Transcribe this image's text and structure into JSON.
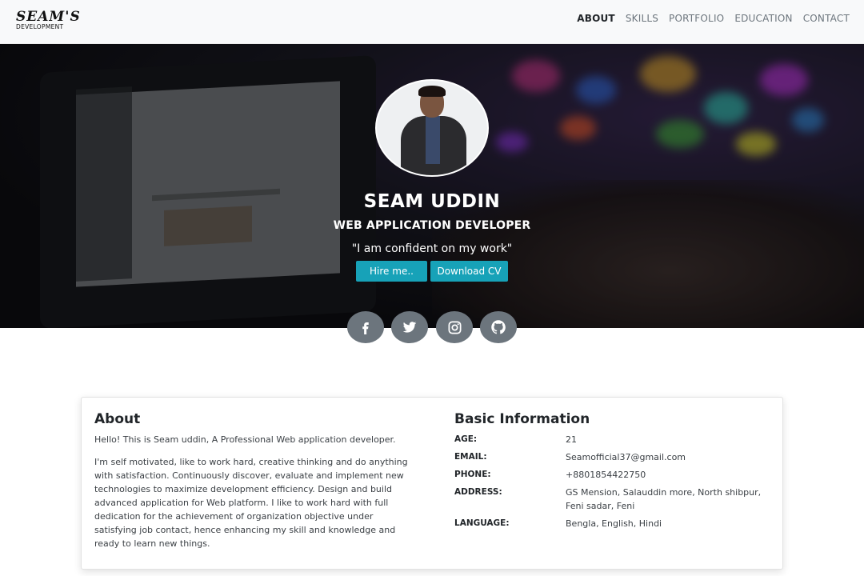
{
  "brand": {
    "title": "SEAM'S",
    "subtitle": "DEVELOPMENT"
  },
  "nav": {
    "items": [
      {
        "label": "ABOUT",
        "active": true
      },
      {
        "label": "SKILLS",
        "active": false
      },
      {
        "label": "PORTFOLIO",
        "active": false
      },
      {
        "label": "EDUCATION",
        "active": false
      },
      {
        "label": "CONTACT",
        "active": false
      }
    ]
  },
  "hero": {
    "name": "SEAM UDDIN",
    "role": "WEB APPLICATION DEVELOPER",
    "quote": "\"I am confident on my work\"",
    "hire_label": "Hire me..",
    "cv_label": "Download CV"
  },
  "social": {
    "icons": [
      "facebook-icon",
      "twitter-icon",
      "instagram-icon",
      "github-icon"
    ]
  },
  "about": {
    "heading": "About",
    "intro": "Hello! This is Seam uddin, A Professional Web application developer.",
    "body": "I'm self motivated, like to work hard, creative thinking and do anything with satisfaction. Continuously discover, evaluate and implement new technologies to maximize development efficiency. Design and build advanced application for Web platform. I like to work hard with full dedication for the achievement of organization objective under satisfying job contact, hence enhancing my skill and knowledge and ready to learn new things."
  },
  "basic": {
    "heading": "Basic Information",
    "rows": [
      {
        "key": "AGE:",
        "value": "21"
      },
      {
        "key": "EMAIL:",
        "value": "Seamofficial37@gmail.com"
      },
      {
        "key": "PHONE:",
        "value": "+8801854422750"
      },
      {
        "key": "ADDRESS:",
        "value": "GS Mension, Salauddin more, North shibpur, Feni sadar, Feni"
      },
      {
        "key": "LANGUAGE:",
        "value": "Bengla, English, Hindi"
      }
    ]
  },
  "colors": {
    "accent": "#17a2b8",
    "social_bg": "#6c757d",
    "nav_bg": "#f8f9fa"
  }
}
